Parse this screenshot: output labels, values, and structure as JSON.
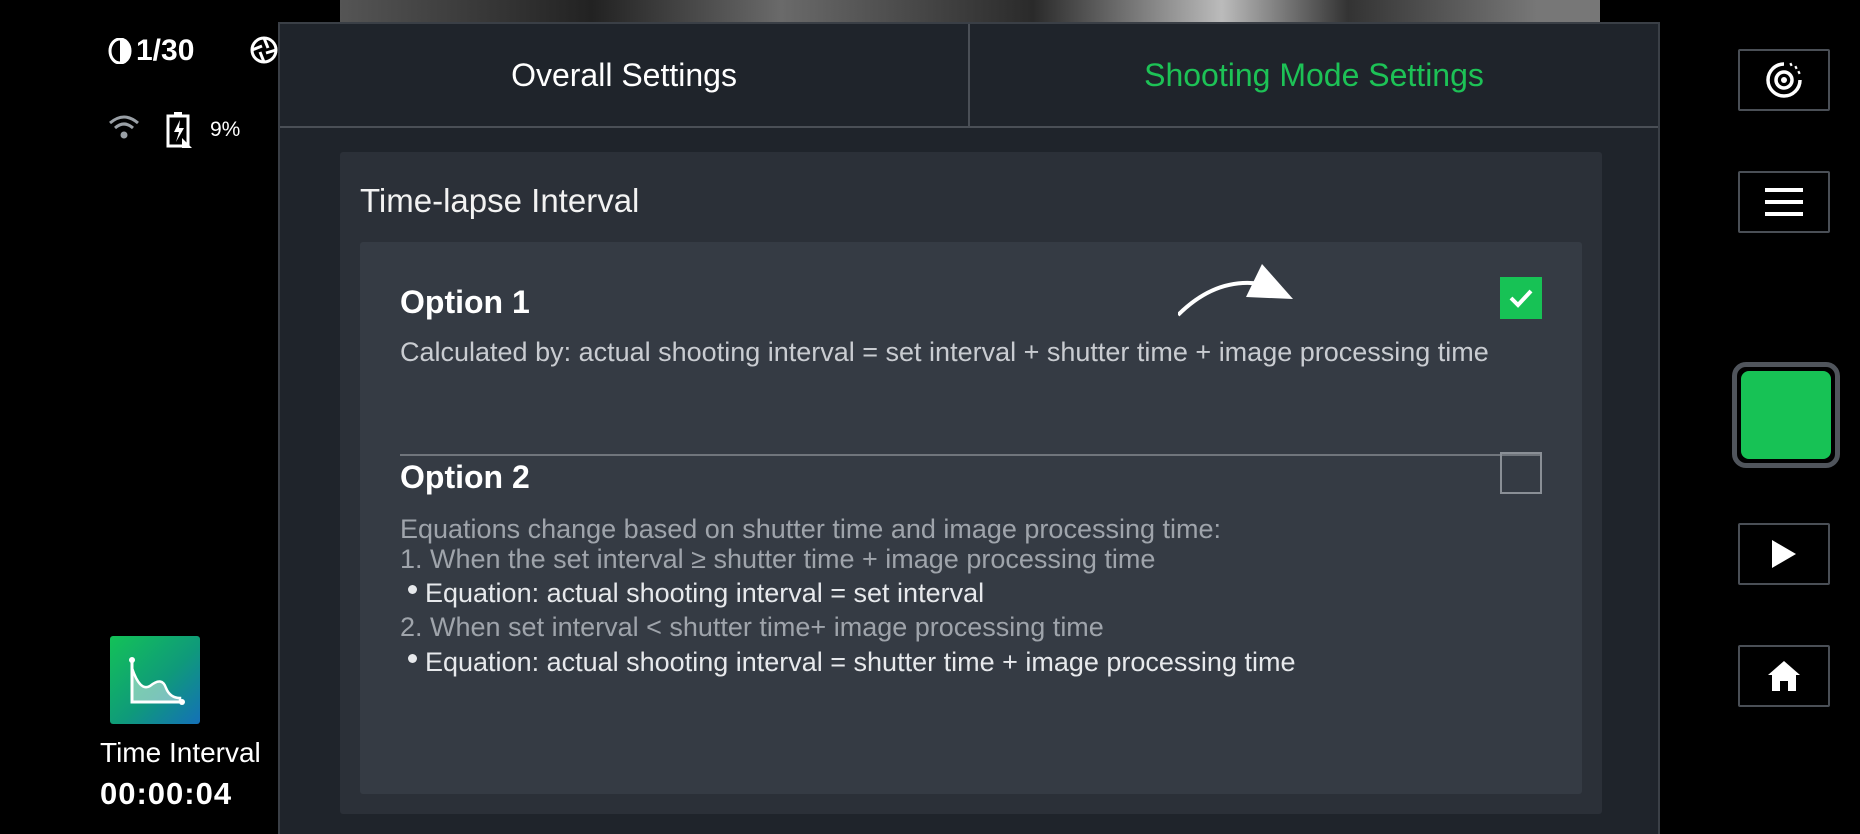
{
  "status": {
    "shutter_speed": "1/30",
    "battery_percent": "9%"
  },
  "mode": {
    "label": "Time Interval",
    "timer": "00:00:04"
  },
  "tabs": [
    {
      "label": "Overall Settings",
      "active": false
    },
    {
      "label": "Shooting Mode Settings",
      "active": true
    }
  ],
  "section": {
    "title": "Time-lapse Interval",
    "option1": {
      "title": "Option 1",
      "checked": true,
      "description": "Calculated by: actual shooting interval = set interval + shutter time + image processing time"
    },
    "option2": {
      "title": "Option 2",
      "checked": false,
      "intro": "Equations change based on shutter time and image processing time:",
      "case1": "1. When the set interval ≥ shutter time + image processing time",
      "case1_equation": "Equation: actual shooting interval = set interval",
      "case2": "2. When set interval <  shutter time+ image processing time",
      "case2_equation": "Equation: actual shooting interval = shutter time + image processing time"
    }
  },
  "colors": {
    "accent": "#17c255",
    "panel": "#1f242b",
    "card": "#353b44"
  }
}
